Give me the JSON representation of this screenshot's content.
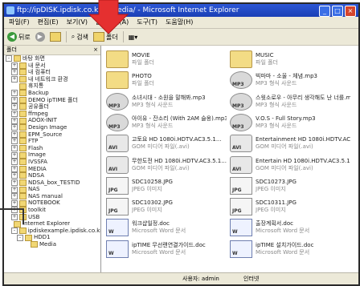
{
  "window": {
    "title": "ftp://ipDISK.ipdisk.co.kr/ · media/ - Microsoft Internet Explorer",
    "controls": [
      "_",
      "□",
      "×"
    ]
  },
  "menu": [
    "파일(F)",
    "편집(E)",
    "보기(V)",
    "즐겨찾기(A)",
    "도구(T)",
    "도움말(H)"
  ],
  "toolbar": {
    "back": "뒤로",
    "forward": "",
    "search": "검색",
    "folders": "폴더",
    "views": ""
  },
  "folders_pane": {
    "header": "폴더",
    "close": "×",
    "items": [
      {
        "label": "바탕 화면",
        "exp": "-"
      },
      {
        "label": "내 문서",
        "exp": "+"
      },
      {
        "label": "내 컴퓨터",
        "exp": "+"
      },
      {
        "label": "내 네트워크 환경",
        "exp": "+"
      },
      {
        "label": "휴지통",
        "exp": ""
      },
      {
        "label": "Backup",
        "exp": "+"
      },
      {
        "label": "DEMO ipTIME 폴더",
        "exp": "+"
      },
      {
        "label": "공유폴더",
        "exp": "+"
      },
      {
        "label": "ffmpeg",
        "exp": "+"
      },
      {
        "label": "ADOX-INIT",
        "exp": "+"
      },
      {
        "label": "Design Image",
        "exp": "+"
      },
      {
        "label": "EPM_Source",
        "exp": "+"
      },
      {
        "label": "FTP",
        "exp": "+"
      },
      {
        "label": "Flash",
        "exp": "+"
      },
      {
        "label": "Image",
        "exp": "+"
      },
      {
        "label": "IVSSFA",
        "exp": "+"
      },
      {
        "label": "MEDIA",
        "exp": "+"
      },
      {
        "label": "NDSA",
        "exp": "+"
      },
      {
        "label": "NDSA_box_TESTID",
        "exp": "+"
      },
      {
        "label": "NAS",
        "exp": "+"
      },
      {
        "label": "NAS manual",
        "exp": "+"
      },
      {
        "label": "NOTEBOOK",
        "exp": "+"
      },
      {
        "label": "toolkit",
        "exp": "+"
      },
      {
        "label": "USB",
        "exp": "+"
      },
      {
        "label": "Internet Explorer",
        "exp": ""
      },
      {
        "label": "ipdiskexample.ipdisk.co.kr",
        "exp": "-"
      },
      {
        "label": "HDD1",
        "exp": "-"
      },
      {
        "label": "Media",
        "exp": ""
      }
    ]
  },
  "files": [
    {
      "type": "folder",
      "tag": "",
      "name": "MOVIE",
      "sub": "파일 폴더"
    },
    {
      "type": "folder",
      "tag": "",
      "name": "MUSIC",
      "sub": "파일 폴더"
    },
    {
      "type": "folder",
      "tag": "",
      "name": "PHOTO",
      "sub": "파일 폴더"
    },
    {
      "type": "mp3",
      "tag": "MP3",
      "name": "빅마마 - 소울 - 체념.mp3",
      "sub": "MP3 형식 사운드"
    },
    {
      "type": "mp3",
      "tag": "MP3",
      "name": "소녀시대 - 소원을 말해봐.mp3",
      "sub": "MP3 형식 사운드"
    },
    {
      "type": "mp3",
      "tag": "MP3",
      "name": "스윗소로우 - 아무리 생각해도 난 너를.mp3",
      "sub": "MP3 형식 사운드"
    },
    {
      "type": "mp3",
      "tag": "MP3",
      "name": "아이유 - 잔소리 (With 2AM 슬옹).mp3",
      "sub": "MP3 형식 사운드"
    },
    {
      "type": "mp3",
      "tag": "MP3",
      "name": "V.O.S - Full Story.mp3",
      "sub": "MP3 형식 사운드"
    },
    {
      "type": "avi",
      "tag": "AVI",
      "name": "고토요 HD 1080i.HDTV.AC3.5.1...",
      "sub": "GOM 미디어 파일(.avi)"
    },
    {
      "type": "avi",
      "tag": "AVI",
      "name": "Entertainment HD 1080i.HDTV.AC3.5.1...",
      "sub": "GOM 미디어 파일(.avi)"
    },
    {
      "type": "avi",
      "tag": "AVI",
      "name": "무한도전 HD 1080i.HDTV.AC3.5.1...",
      "sub": "GOM 미디어 파일(.avi)"
    },
    {
      "type": "avi",
      "tag": "AVI",
      "name": "Entertain HD 1080i.HDTV.AC3.5.1...",
      "sub": "GOM 미디어 파일(.avi)"
    },
    {
      "type": "jpg",
      "tag": "JPG",
      "name": "SDC10258.JPG",
      "sub": "JPEG 이미지"
    },
    {
      "type": "jpg",
      "tag": "JPG",
      "name": "SDC10273.JPG",
      "sub": "JPEG 이미지"
    },
    {
      "type": "jpg",
      "tag": "JPG",
      "name": "SDC10302.JPG",
      "sub": "JPEG 이미지"
    },
    {
      "type": "jpg",
      "tag": "JPG",
      "name": "SDC10311.JPG",
      "sub": "JPEG 이미지"
    },
    {
      "type": "doc",
      "tag": "W",
      "name": "워크샵일정.doc",
      "sub": "Microsoft Word 문서"
    },
    {
      "type": "doc",
      "tag": "W",
      "name": "출장계획서.doc",
      "sub": "Microsoft Word 문서"
    },
    {
      "type": "doc",
      "tag": "W",
      "name": "ipTIME 무선랜연결가이드.doc",
      "sub": "Microsoft Word 문서"
    },
    {
      "type": "doc",
      "tag": "W",
      "name": "ipTIME 설치가이드.doc",
      "sub": "Microsoft Word 문서"
    }
  ],
  "status": {
    "user": "사용자: admin",
    "zone": "인터넷"
  },
  "colors": {
    "titlebar": "#1f47c4",
    "highlight_arrow": "#e53030"
  }
}
